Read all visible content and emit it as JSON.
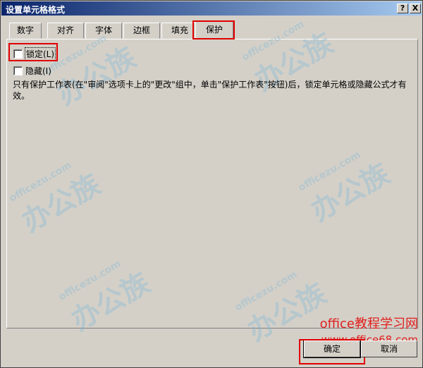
{
  "window": {
    "title": "设置单元格格式",
    "help_glyph": "?",
    "close_glyph": "X"
  },
  "tabs": [
    {
      "label": "数字"
    },
    {
      "label": "对齐"
    },
    {
      "label": "字体"
    },
    {
      "label": "边框"
    },
    {
      "label": "填充"
    },
    {
      "label": "保护"
    }
  ],
  "active_tab": "保护",
  "protection": {
    "locked": {
      "label": "锁定(L)",
      "checked": false
    },
    "hidden": {
      "label": "隐藏(I)",
      "checked": false
    },
    "info_text": "只有保护工作表(在\"审阅\"选项卡上的\"更改\"组中，单击\"保护工作表\"按钮)后，锁定单元格或隐藏公式才有效。"
  },
  "buttons": {
    "ok": "确定",
    "cancel": "取消"
  },
  "watermark": {
    "cn": "办公族",
    "en": "officezu.com",
    "site_line1": "office教程学习网",
    "site_line2": "www.office68.com"
  },
  "colors": {
    "highlight": "#e00000",
    "titlebar_start": "#0a246a",
    "titlebar_end": "#a6caf0",
    "dialog_bg": "#d4d0c8"
  }
}
